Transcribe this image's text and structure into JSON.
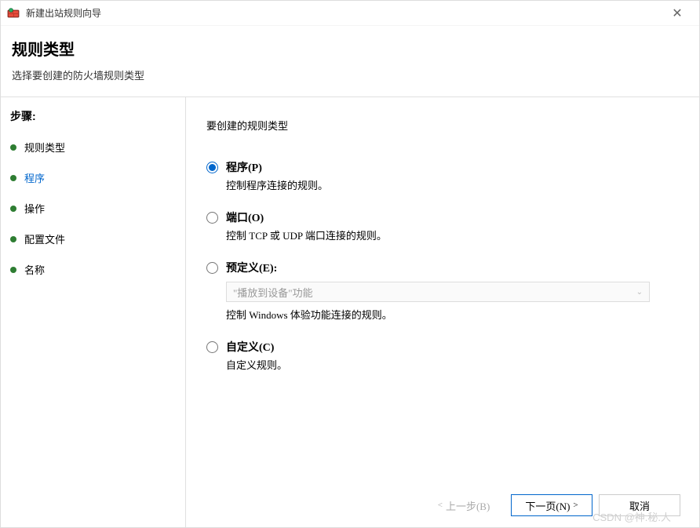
{
  "window": {
    "title": "新建出站规则向导"
  },
  "header": {
    "title": "规则类型",
    "subtitle": "选择要创建的防火墙规则类型"
  },
  "sidebar": {
    "steps_label": "步骤:",
    "items": [
      {
        "label": "规则类型",
        "active": false
      },
      {
        "label": "程序",
        "active": true
      },
      {
        "label": "操作",
        "active": false
      },
      {
        "label": "配置文件",
        "active": false
      },
      {
        "label": "名称",
        "active": false
      }
    ]
  },
  "main": {
    "prompt": "要创建的规则类型",
    "options": [
      {
        "id": "program",
        "label": "程序(P)",
        "description": "控制程序连接的规则。",
        "selected": true
      },
      {
        "id": "port",
        "label": "端口(O)",
        "description": "控制 TCP 或 UDP 端口连接的规则。",
        "selected": false
      },
      {
        "id": "predefined",
        "label": "预定义(E):",
        "select_placeholder": "\"播放到设备\"功能",
        "description": "控制 Windows 体验功能连接的规则。",
        "selected": false
      },
      {
        "id": "custom",
        "label": "自定义(C)",
        "description": "自定义规则。",
        "selected": false
      }
    ]
  },
  "buttons": {
    "back": "上一步(B)",
    "next": "下一页(N)",
    "cancel": "取消"
  },
  "watermark": "CSDN @神.秘.人"
}
